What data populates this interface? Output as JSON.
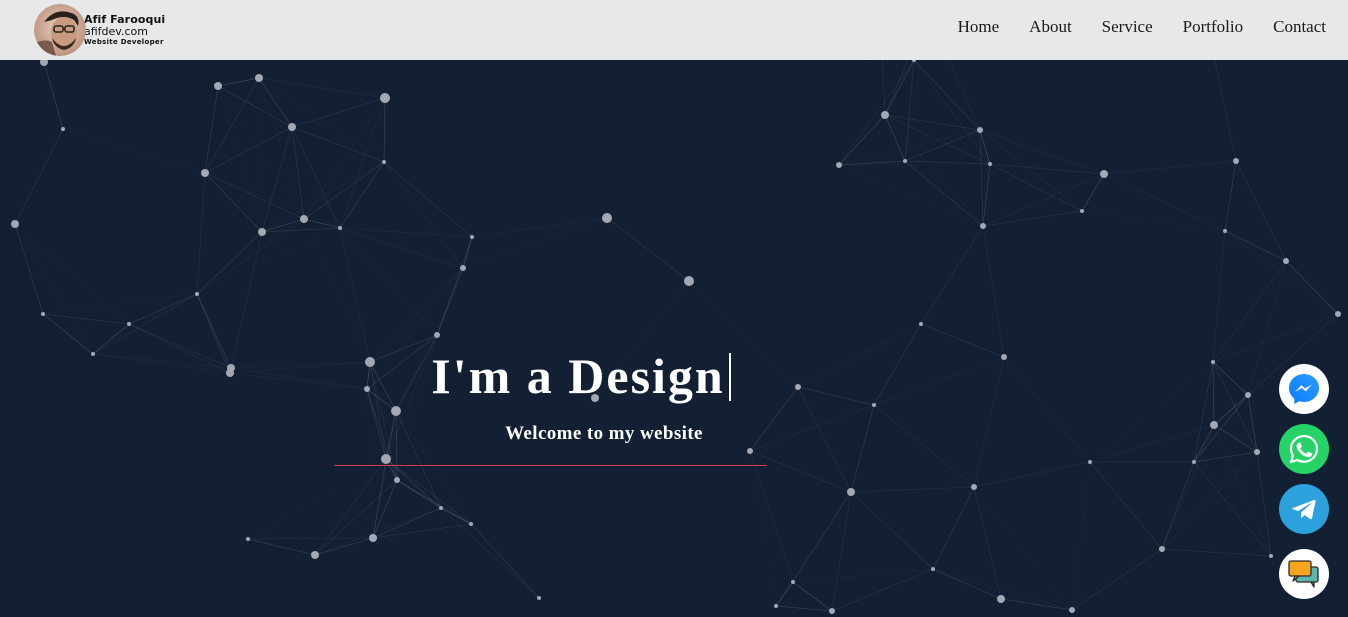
{
  "brand": {
    "name": "Afif Farooqui",
    "domain": "afifdev.com",
    "role": "Website  Developer"
  },
  "nav": {
    "items": [
      "Home",
      "About",
      "Service",
      "Portfolio",
      "Contact"
    ]
  },
  "hero": {
    "headline": "I'm a Design",
    "subtitle": "Welcome to my website"
  },
  "floating_buttons": {
    "icons": [
      "messenger-icon",
      "whatsapp-icon",
      "telegram-icon",
      "chat-icon"
    ]
  },
  "colors": {
    "background": "#131f33",
    "navbar": "#e7e8ea",
    "underline": "#d63a4a",
    "whatsapp": "#25d366",
    "telegram": "#2da1dc"
  }
}
